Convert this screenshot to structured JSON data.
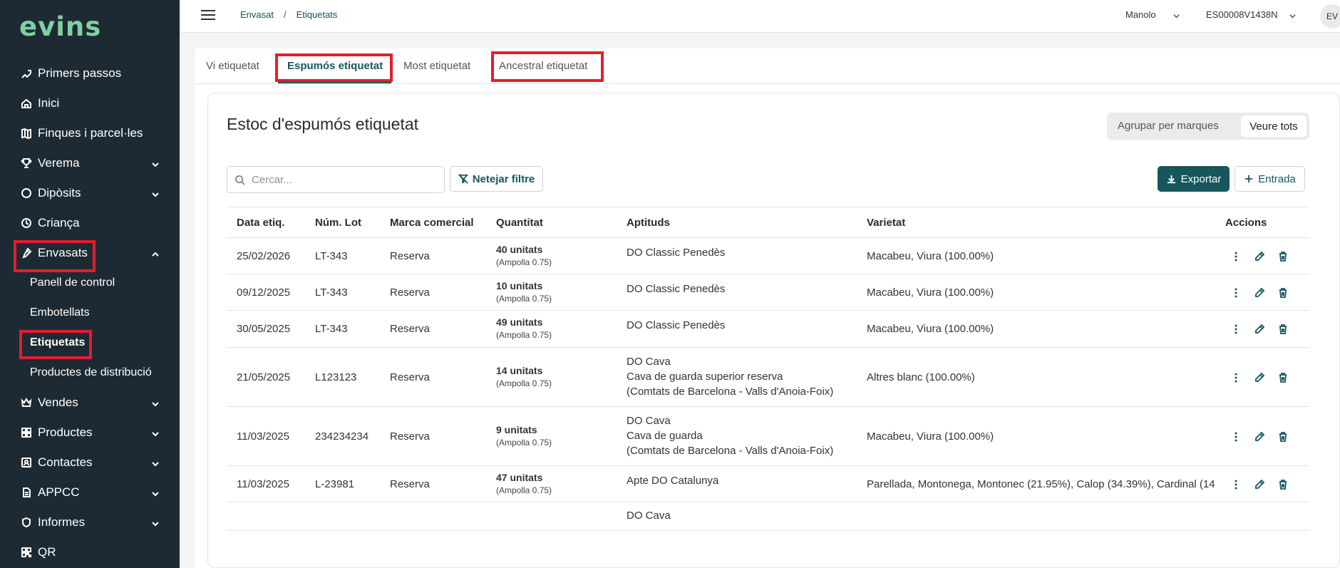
{
  "app": {
    "logo": "evins"
  },
  "sidebar": {
    "items": [
      {
        "label": "Primers passos",
        "icon": "steps-icon",
        "chevron": false
      },
      {
        "label": "Inici",
        "icon": "home-icon",
        "chevron": false
      },
      {
        "label": "Finques i parcel·les",
        "icon": "map-icon",
        "chevron": false
      },
      {
        "label": "Verema",
        "icon": "trophy-icon",
        "chevron": true
      },
      {
        "label": "Dipòsits",
        "icon": "circle-icon",
        "chevron": true
      },
      {
        "label": "Criança",
        "icon": "clock-icon",
        "chevron": false
      },
      {
        "label": "Envasats",
        "icon": "bottle-icon",
        "chevron": true,
        "expanded": true
      },
      {
        "label": "Vendes",
        "icon": "crown-icon",
        "chevron": true
      },
      {
        "label": "Productes",
        "icon": "grid-icon",
        "chevron": true
      },
      {
        "label": "Contactes",
        "icon": "contacts-icon",
        "chevron": true
      },
      {
        "label": "APPCC",
        "icon": "document-icon",
        "chevron": true
      },
      {
        "label": "Informes",
        "icon": "shield-icon",
        "chevron": true
      },
      {
        "label": "QR",
        "icon": "qr-icon",
        "chevron": false
      }
    ],
    "envasats_sub": [
      {
        "label": "Panell de control"
      },
      {
        "label": "Embotellats"
      },
      {
        "label": "Etiquetats",
        "active": true
      },
      {
        "label": "Productes de distribució"
      }
    ]
  },
  "topbar": {
    "breadcrumb": [
      "Envasat",
      "Etiquetats"
    ],
    "breadcrumb_sep": "/",
    "user": "Manolo",
    "org": "ES00008V1438N",
    "avatar": "EV"
  },
  "tabs": [
    "Vi etiquetat",
    "Espumós etiquetat",
    "Most etiquetat",
    "Ancestral etiquetat"
  ],
  "active_tab": "Espumós etiquetat",
  "card": {
    "title": "Estoc d'espumós etiquetat",
    "toggle": [
      "Agrupar per marques",
      "Veure tots"
    ],
    "toggle_selected": "Veure tots",
    "search_placeholder": "Cercar...",
    "clear_filter": "Netejar filtre",
    "export": "Exportar",
    "entry": "Entrada"
  },
  "table": {
    "columns": [
      "Data etiq.",
      "Núm. Lot",
      "Marca comercial",
      "Quantitat",
      "Aptituds",
      "Varietat",
      "Accions"
    ],
    "rows": [
      {
        "date": "25/02/2026",
        "lot": "LT-343",
        "brand": "Reserva",
        "qty": "40 unitats",
        "qty_sub": "(Ampolla 0.75)",
        "aptituds": [
          "DO Classic Penedès"
        ],
        "varietat": "Macabeu, Viura (100.00%)"
      },
      {
        "date": "09/12/2025",
        "lot": "LT-343",
        "brand": "Reserva",
        "qty": "10 unitats",
        "qty_sub": "(Ampolla 0.75)",
        "aptituds": [
          "DO Classic Penedès"
        ],
        "varietat": "Macabeu, Viura (100.00%)"
      },
      {
        "date": "30/05/2025",
        "lot": "LT-343",
        "brand": "Reserva",
        "qty": "49 unitats",
        "qty_sub": "(Ampolla 0.75)",
        "aptituds": [
          "DO Classic Penedès"
        ],
        "varietat": "Macabeu, Viura (100.00%)"
      },
      {
        "date": "21/05/2025",
        "lot": "L123123",
        "brand": "Reserva",
        "qty": "14 unitats",
        "qty_sub": "(Ampolla 0.75)",
        "aptituds": [
          "DO Cava",
          "Cava de guarda superior reserva",
          "(Comtats de Barcelona - Valls d'Anoia-Foix)"
        ],
        "varietat": "Altres blanc (100.00%)"
      },
      {
        "date": "11/03/2025",
        "lot": "234234234",
        "brand": "Reserva",
        "qty": "9 unitats",
        "qty_sub": "(Ampolla 0.75)",
        "aptituds": [
          "DO Cava",
          "Cava de guarda",
          "(Comtats de Barcelona - Valls d'Anoia-Foix)"
        ],
        "varietat": "Macabeu, Viura (100.00%)"
      },
      {
        "date": "11/03/2025",
        "lot": "L-23981",
        "brand": "Reserva",
        "qty": "47 unitats",
        "qty_sub": "(Ampolla 0.75)",
        "aptituds": [
          "Apte DO Catalunya"
        ],
        "varietat": "Parellada, Montonega, Montonec (21.95%), Calop (34.39%), Cardinal (14"
      },
      {
        "date": "",
        "lot": "",
        "brand": "",
        "qty": "",
        "qty_sub": "",
        "aptituds": [
          "DO Cava"
        ],
        "varietat": ""
      }
    ]
  }
}
